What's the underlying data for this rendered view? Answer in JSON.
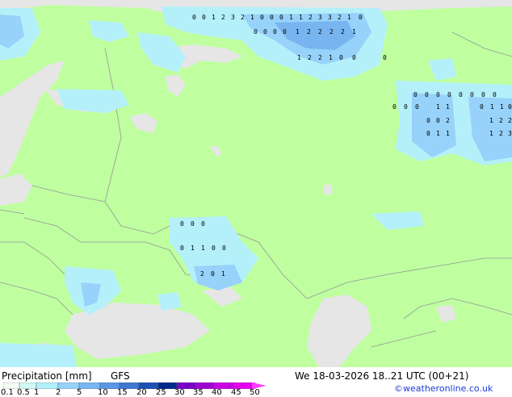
{
  "map": {
    "colors": {
      "land": "#bfffa0",
      "sea": "#e6e6e6",
      "border": "#969696",
      "precip_light": "#b4f0fa",
      "precip_mid": "#96d2fa",
      "precip_heavy": "#78b4f0"
    },
    "labels_row1": [
      "0",
      "0",
      "1",
      "2",
      "3",
      "2",
      "1",
      "0",
      "0",
      "0",
      "1",
      "1",
      "2",
      "3",
      "3",
      "2",
      "1",
      "0"
    ],
    "labels_row2": [
      "0",
      "0",
      "0",
      "0",
      "1",
      "2",
      "2",
      "2",
      "2",
      "1"
    ],
    "labels_row3": [
      "1",
      "2",
      "2",
      "1",
      "0",
      "0",
      "0"
    ],
    "labels_east1": [
      "0",
      "0",
      "0",
      "0",
      "0",
      "0",
      "0",
      "0"
    ],
    "labels_east2": [
      "0",
      "0",
      "0",
      "1",
      "1",
      "0",
      "1",
      "1",
      "0"
    ],
    "labels_east3": [
      "0",
      "0",
      "2",
      "1",
      "2",
      "2"
    ],
    "labels_east4": [
      "0",
      "1",
      "1",
      "1",
      "2",
      "3"
    ],
    "labels_south1": [
      "0",
      "0",
      "0"
    ],
    "labels_south2": [
      "0",
      "1",
      "1",
      "0",
      "0"
    ],
    "labels_south3": [
      "2",
      "0",
      "1"
    ]
  },
  "footer": {
    "title": "Precipitation [mm]",
    "model": "GFS",
    "datetime": "We 18-03-2026 18..21 UTC (00+21)",
    "credit": "©weatheronline.co.uk",
    "scale_ticks": [
      "0.1",
      "0.5",
      "1",
      "2",
      "5",
      "10",
      "15",
      "20",
      "25",
      "30",
      "35",
      "40",
      "45",
      "50"
    ],
    "scale_colors": [
      "#f5fff5",
      "#d2faf5",
      "#b4f0fa",
      "#96d2fa",
      "#78b4f0",
      "#5a96e6",
      "#3c78d2",
      "#1e50b4",
      "#00288c",
      "#7800c8",
      "#a000d2",
      "#c800e6",
      "#e600f0",
      "#ff3cff"
    ]
  }
}
